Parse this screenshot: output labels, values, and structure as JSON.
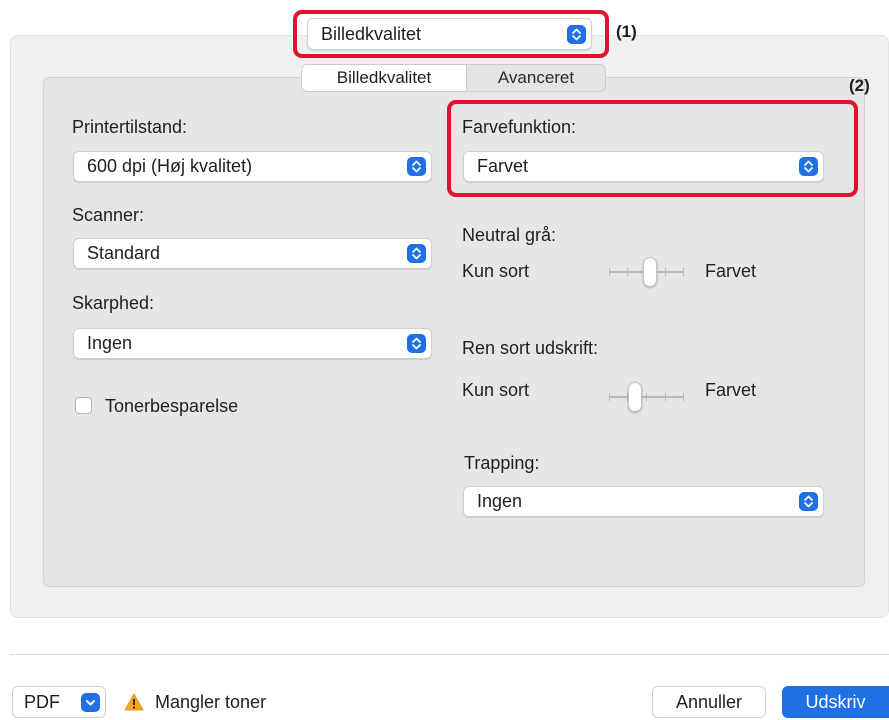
{
  "header": {
    "preset_popup_value": "Billedkvalitet",
    "callout_1": "(1)",
    "callout_2": "(2)"
  },
  "tabs": [
    {
      "label": "Billedkvalitet",
      "active": true
    },
    {
      "label": "Avanceret",
      "active": false
    }
  ],
  "left": {
    "printer_mode_label": "Printertilstand:",
    "printer_mode_value": "600 dpi (Høj kvalitet)",
    "scanner_label": "Scanner:",
    "scanner_value": "Standard",
    "sharpness_label": "Skarphed:",
    "sharpness_value": "Ingen",
    "toner_save_label": "Tonerbesparelse",
    "toner_save_checked": false
  },
  "right": {
    "color_mode_label": "Farvefunktion:",
    "color_mode_value": "Farvet",
    "neutral_gray_label": "Neutral grå:",
    "neutral_gray_min": "Kun sort",
    "neutral_gray_max": "Farvet",
    "neutral_gray_level": 0.55,
    "pure_black_label": "Ren sort udskrift:",
    "pure_black_min": "Kun sort",
    "pure_black_max": "Farvet",
    "pure_black_level": 0.35,
    "trapping_label": "Trapping:",
    "trapping_value": "Ingen"
  },
  "footer": {
    "pdf_label": "PDF",
    "warning_text": "Mangler toner",
    "cancel_label": "Annuller",
    "print_label": "Udskriv"
  },
  "colors": {
    "accent": "#1f6fe5",
    "highlight": "#e0122f",
    "warning": "#f5a623"
  }
}
